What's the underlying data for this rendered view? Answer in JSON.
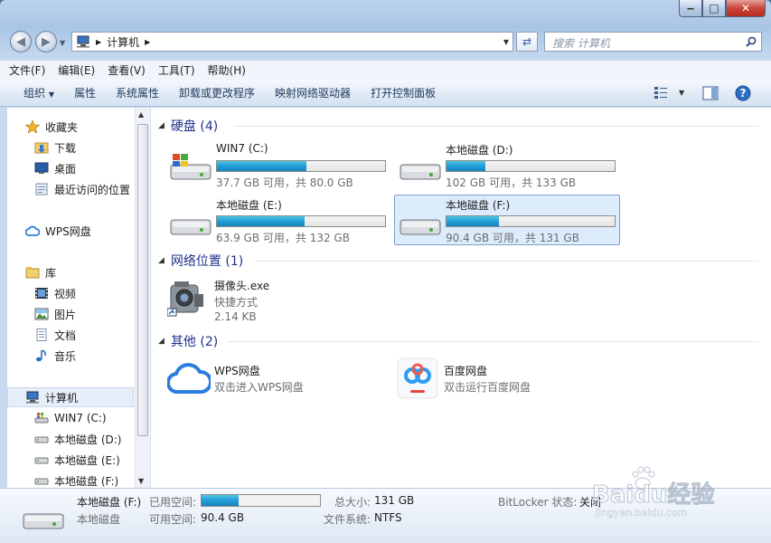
{
  "window": {
    "controls": {
      "min": "‒",
      "max": "□",
      "close": "✕"
    }
  },
  "address": {
    "crumb": "计算机"
  },
  "search": {
    "placeholder": "搜索 计算机"
  },
  "menu": [
    "文件(F)",
    "编辑(E)",
    "查看(V)",
    "工具(T)",
    "帮助(H)"
  ],
  "toolbar": {
    "organize": "组织",
    "commands": [
      "属性",
      "系统属性",
      "卸载或更改程序",
      "映射网络驱动器",
      "打开控制面板"
    ]
  },
  "nav": {
    "favorites": "收藏夹",
    "downloads": "下载",
    "desktop": "桌面",
    "recent": "最近访问的位置",
    "wps": "WPS网盘",
    "libraries": "库",
    "videos": "视频",
    "pictures": "图片",
    "documents": "文档",
    "music": "音乐",
    "computer": "计算机",
    "drives": [
      "WIN7 (C:)",
      "本地磁盘 (D:)",
      "本地磁盘 (E:)",
      "本地磁盘 (F:)"
    ]
  },
  "groups": {
    "hard_disks": "硬盘 (4)",
    "network": "网络位置 (1)",
    "other": "其他 (2)"
  },
  "drives": [
    {
      "name": "WIN7 (C:)",
      "info": "37.7 GB 可用，共 80.0 GB",
      "used_fraction": 0.53
    },
    {
      "name": "本地磁盘 (D:)",
      "info": "102 GB 可用，共 133 GB",
      "used_fraction": 0.23
    },
    {
      "name": "本地磁盘 (E:)",
      "info": "63.9 GB 可用，共 132 GB",
      "used_fraction": 0.52
    },
    {
      "name": "本地磁盘 (F:)",
      "info": "90.4 GB 可用，共 131 GB",
      "used_fraction": 0.31
    }
  ],
  "network_items": [
    {
      "name": "摄像头.exe",
      "type": "快捷方式",
      "size": "2.14 KB"
    }
  ],
  "other_items": [
    {
      "name": "WPS网盘",
      "desc": "双击进入WPS网盘"
    },
    {
      "name": "百度网盘",
      "desc": "双击运行百度网盘"
    }
  ],
  "details": {
    "name": "本地磁盘 (F:)",
    "type": "本地磁盘",
    "used_label": "已用空间:",
    "used_fraction": 0.31,
    "free_label": "可用空间:",
    "free_value": "90.4 GB",
    "total_label": "总大小:",
    "total_value": "131 GB",
    "fs_label": "文件系统:",
    "fs_value": "NTFS",
    "bitlocker_label": "BitLocker 状态:",
    "bitlocker_value": "关闭"
  },
  "watermark": {
    "brand": "Baidu经验",
    "url": "jingyan.baidu.com"
  },
  "colors": {
    "accent": "#26a0da",
    "group_heading": "#1e3287",
    "selection": "#ddecfc"
  }
}
